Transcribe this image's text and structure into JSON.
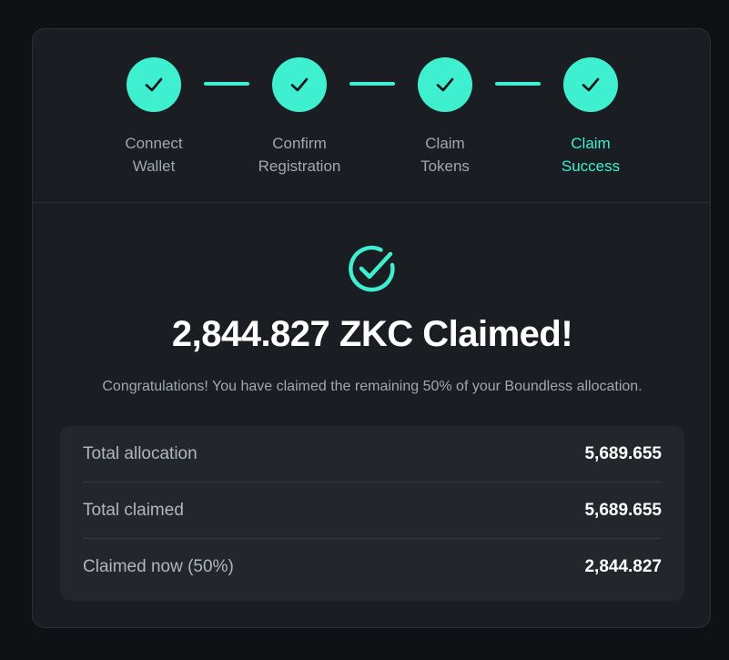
{
  "colors": {
    "accent": "#3ef0cf",
    "card_background": "#1a1d21",
    "page_background": "#0f1114",
    "summary_background": "#23272c"
  },
  "steps": [
    {
      "label": "Connect\nWallet",
      "icon": "check-icon",
      "state": "complete"
    },
    {
      "label": "Confirm\nRegistration",
      "icon": "check-icon",
      "state": "complete"
    },
    {
      "label": "Claim\nTokens",
      "icon": "check-icon",
      "state": "complete"
    },
    {
      "label": "Claim\nSuccess",
      "icon": "check-icon",
      "state": "current"
    }
  ],
  "success": {
    "icon": "check-circle-icon",
    "headline": "2,844.827 ZKC Claimed!",
    "message": "Congratulations! You have claimed the remaining 50% of your Boundless allocation."
  },
  "summary": {
    "rows": [
      {
        "label": "Total allocation",
        "value": "5,689.655"
      },
      {
        "label": "Total claimed",
        "value": "5,689.655"
      },
      {
        "label": "Claimed now (50%)",
        "value": "2,844.827"
      }
    ]
  }
}
